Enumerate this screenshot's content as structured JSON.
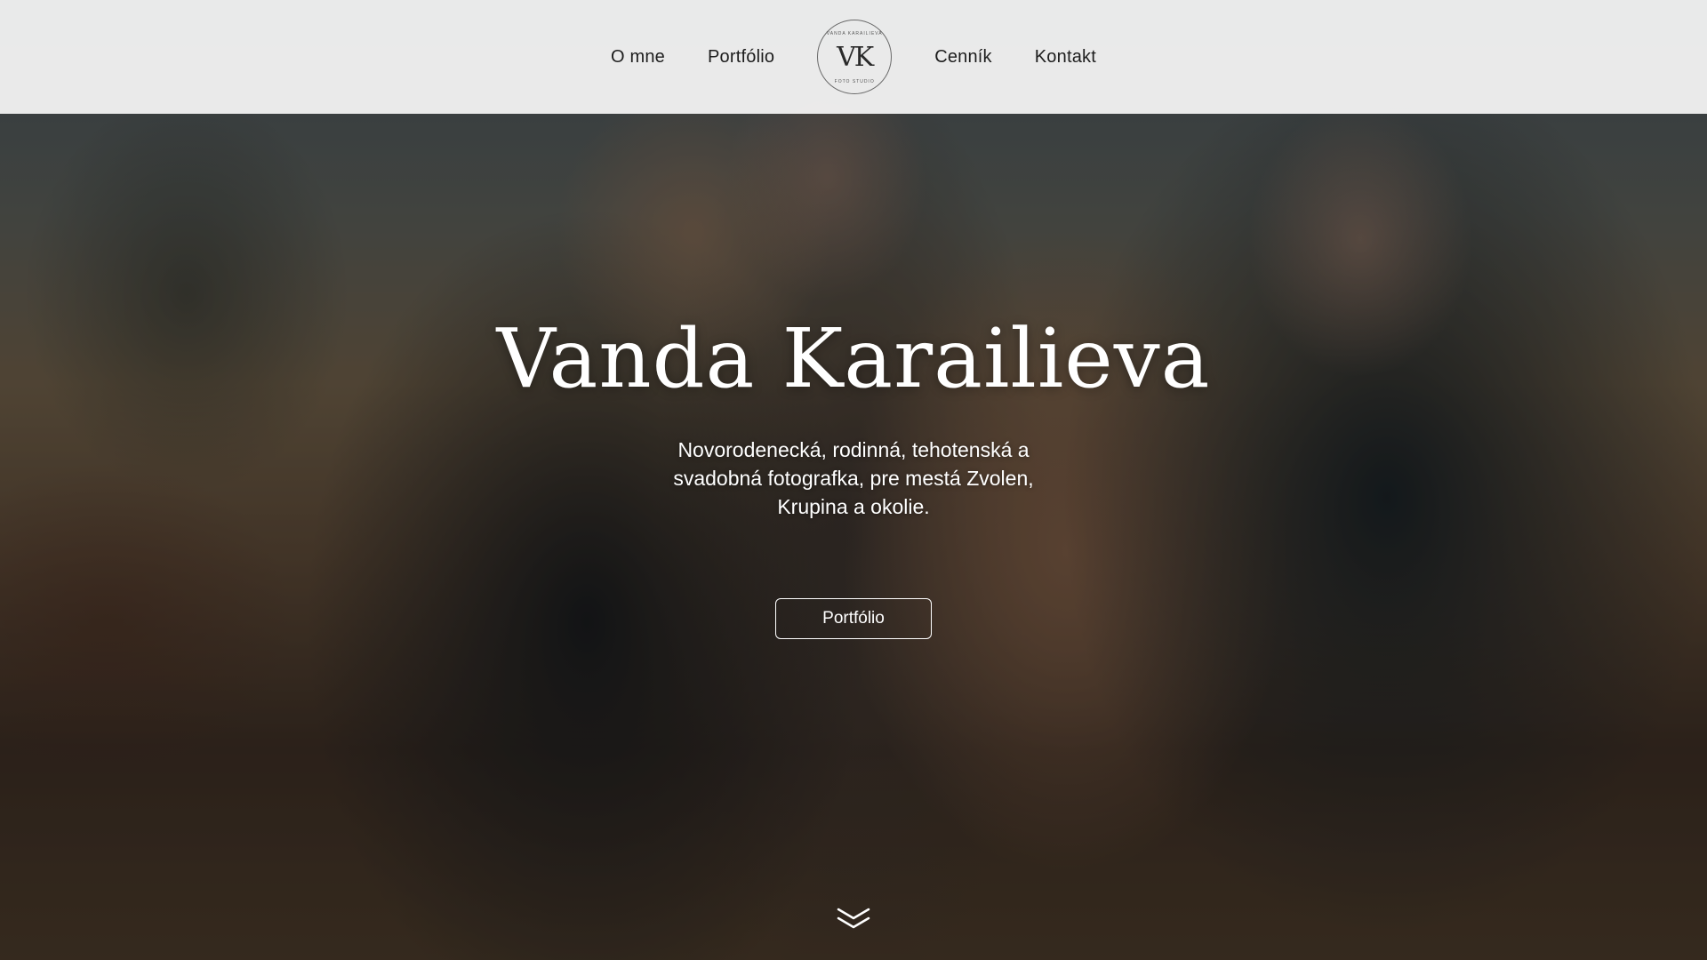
{
  "nav": {
    "left": [
      {
        "label": "O mne"
      },
      {
        "label": "Portfólio"
      }
    ],
    "logo": {
      "monogram": "VK",
      "ring_top": "VANDA KARAILIEVA",
      "ring_bottom": "FOTO STUDIO"
    },
    "right": [
      {
        "label": "Cenník"
      },
      {
        "label": "Kontakt"
      }
    ]
  },
  "hero": {
    "title": "Vanda Karailieva",
    "subtitle": "Novorodenecká, rodinná, tehotenská a svadobná fotografka, pre mestá Zvolen, Krupina a okolie.",
    "cta_label": "Portfólio",
    "scroll_icon": "double-chevron-down-icon"
  },
  "colors": {
    "header_bg": "#f8f8f7",
    "nav_text": "#1d1d1d",
    "hero_text": "#ffffff"
  }
}
